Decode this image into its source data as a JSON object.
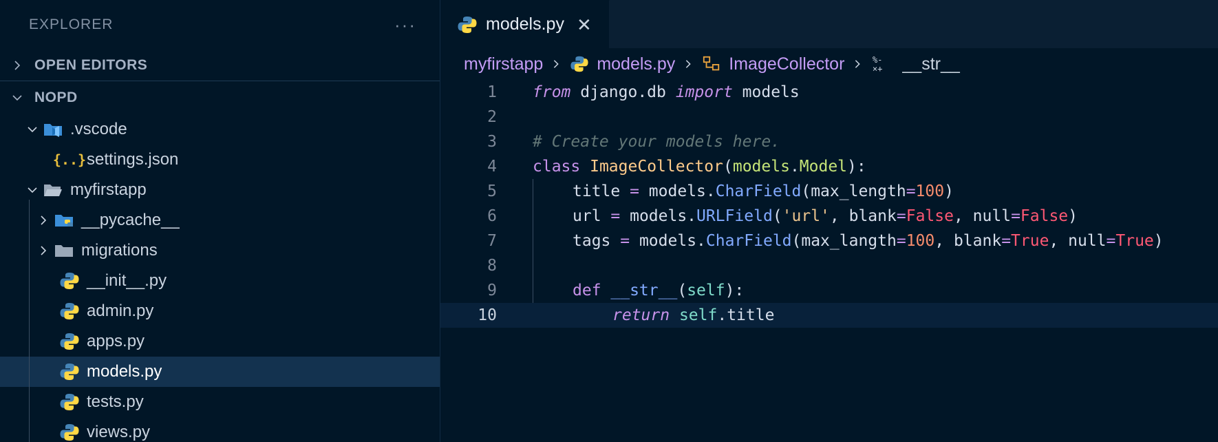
{
  "explorer": {
    "title": "EXPLORER",
    "more": "···",
    "open_editors": "OPEN EDITORS",
    "workspace": "NOPD",
    "tree": [
      {
        "label": ".vscode",
        "type": "folder-vscode",
        "expanded": true
      },
      {
        "label": "settings.json",
        "type": "json"
      },
      {
        "label": "myfirstapp",
        "type": "folder",
        "expanded": true
      },
      {
        "label": "__pycache__",
        "type": "folder-python",
        "expanded": false
      },
      {
        "label": "migrations",
        "type": "folder",
        "expanded": false
      },
      {
        "label": "__init__.py",
        "type": "python"
      },
      {
        "label": "admin.py",
        "type": "python"
      },
      {
        "label": "apps.py",
        "type": "python"
      },
      {
        "label": "models.py",
        "type": "python",
        "selected": true
      },
      {
        "label": "tests.py",
        "type": "python"
      },
      {
        "label": "views.py",
        "type": "python"
      }
    ]
  },
  "editor": {
    "tab": {
      "label": "models.py",
      "close": "✕"
    },
    "breadcrumb": [
      "myfirstapp",
      "models.py",
      "ImageCollector",
      "__str__"
    ],
    "line_numbers": [
      "1",
      "2",
      "3",
      "4",
      "5",
      "6",
      "7",
      "8",
      "9",
      "10"
    ],
    "code_text": {
      "l1_from": "from",
      "l1_mod": " django.db ",
      "l1_import": "import",
      "l1_name": " models",
      "l3_comment": "# Create your models here.",
      "l4_class": "class",
      "l4_name": "ImageCollector",
      "l4_paren": "(",
      "l4_base": "models",
      "l4_dot": ".",
      "l4_basecls": "Model",
      "l4_end": "):",
      "l5_a": "title ",
      "l5_eq": "=",
      "l5_b": " models.",
      "l5_fn": "CharField",
      "l5_c": "(max_length",
      "l5_eq2": "=",
      "l5_num": "100",
      "l5_d": ")",
      "l6_a": "url ",
      "l6_eq": "=",
      "l6_b": " models.",
      "l6_fn": "URLField",
      "l6_c": "(",
      "l6_str": "'url'",
      "l6_d": ", blank",
      "l6_eq2": "=",
      "l6_f1": "False",
      "l6_e": ", null",
      "l6_eq3": "=",
      "l6_f2": "False",
      "l6_g": ")",
      "l7_a": "tags ",
      "l7_eq": "=",
      "l7_b": " models.",
      "l7_fn": "CharField",
      "l7_c": "(max_langth",
      "l7_eq2": "=",
      "l7_num": "100",
      "l7_d": ", blank",
      "l7_eq3": "=",
      "l7_t1": "True",
      "l7_e": ", null",
      "l7_eq4": "=",
      "l7_t2": "True",
      "l7_g": ")",
      "l9_def": "def",
      "l9_name": " __str__",
      "l9_p": "(",
      "l9_self": "self",
      "l9_end": "):",
      "l10_ret": "return",
      "l10_self": " self",
      "l10_rest": ".title"
    }
  },
  "colors": {
    "background": "#011627",
    "selection": "#13324f",
    "keyword": "#c792ea",
    "class": "#ffcb8b",
    "function": "#82aaff",
    "string": "#ecc48d",
    "number": "#f78c6c",
    "boolean": "#ff5874",
    "comment": "#637777"
  }
}
